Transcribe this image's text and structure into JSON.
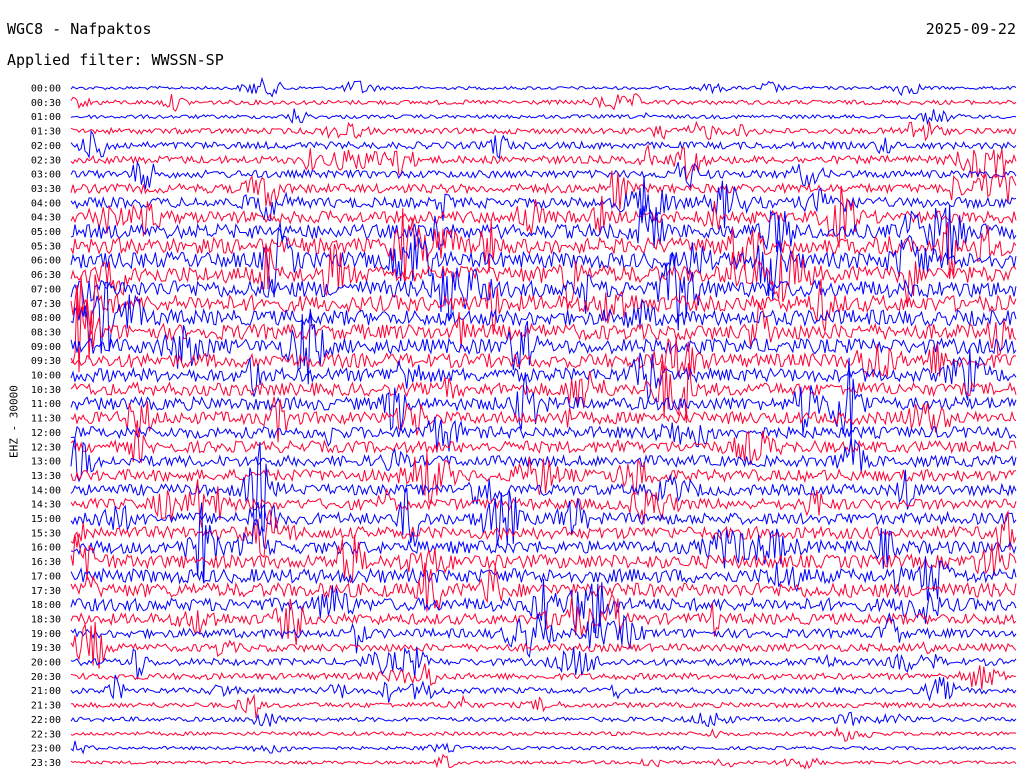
{
  "header": {
    "station": "WGC8 - Nafpaktos",
    "date": "2025-09-22",
    "filter": "Applied filter: WWSSN-SP",
    "channel": "EHZ - 30000"
  },
  "chart_data": {
    "type": "line",
    "row_labels": [
      "00:00",
      "00:30",
      "01:00",
      "01:30",
      "02:00",
      "02:30",
      "03:00",
      "03:30",
      "04:00",
      "04:30",
      "05:00",
      "05:30",
      "06:00",
      "06:30",
      "07:00",
      "07:30",
      "08:00",
      "08:30",
      "09:00",
      "09:30",
      "10:00",
      "10:30",
      "11:00",
      "11:30",
      "12:00",
      "12:30",
      "13:00",
      "13:30",
      "14:00",
      "14:30",
      "15:00",
      "15:30",
      "16:00",
      "16:30",
      "17:00",
      "17:30",
      "18:00",
      "18:30",
      "19:00",
      "19:30",
      "20:00",
      "20:30",
      "21:00",
      "21:30",
      "22:00",
      "22:30",
      "23:00",
      "23:30"
    ],
    "colors": [
      "#0000ff",
      "#ff0033"
    ],
    "relative_amplitude": [
      0.25,
      0.35,
      0.3,
      0.45,
      0.55,
      0.6,
      0.6,
      0.7,
      0.8,
      0.95,
      1.1,
      1.2,
      1.25,
      1.3,
      1.3,
      1.25,
      1.2,
      1.2,
      1.15,
      1.1,
      1.05,
      1.0,
      1.0,
      0.95,
      0.9,
      0.9,
      0.85,
      0.9,
      0.85,
      0.85,
      0.9,
      0.95,
      1.0,
      1.05,
      1.1,
      1.1,
      1.0,
      0.85,
      0.7,
      0.6,
      0.55,
      0.5,
      0.45,
      0.4,
      0.35,
      0.3,
      0.25,
      0.25
    ]
  }
}
